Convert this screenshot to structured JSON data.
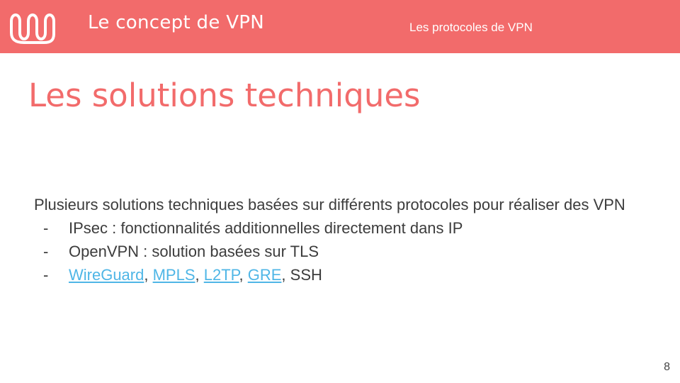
{
  "colors": {
    "accent": "#f26b6b",
    "link": "#4fb6e6",
    "text": "#3c3c3c",
    "background": "#ffffff"
  },
  "header": {
    "logo_icon": "wavy-logo-icon",
    "deck_title": "Le concept de VPN",
    "section_title": "Les protocoles de VPN"
  },
  "slide": {
    "title": "Les solutions techniques",
    "intro": "Plusieurs solutions techniques basées sur différents protocoles pour réaliser des VPN",
    "bullets": [
      {
        "dash": "-",
        "text": "IPsec : fonctionnalités additionnelles directement dans IP"
      },
      {
        "dash": "-",
        "text": "OpenVPN : solution basées sur TLS"
      },
      {
        "dash": "-",
        "links": [
          "WireGuard",
          "MPLS",
          "L2TP",
          "GRE"
        ],
        "separator": ", ",
        "tail": "SSH"
      }
    ]
  },
  "footer": {
    "page_number": "8"
  }
}
